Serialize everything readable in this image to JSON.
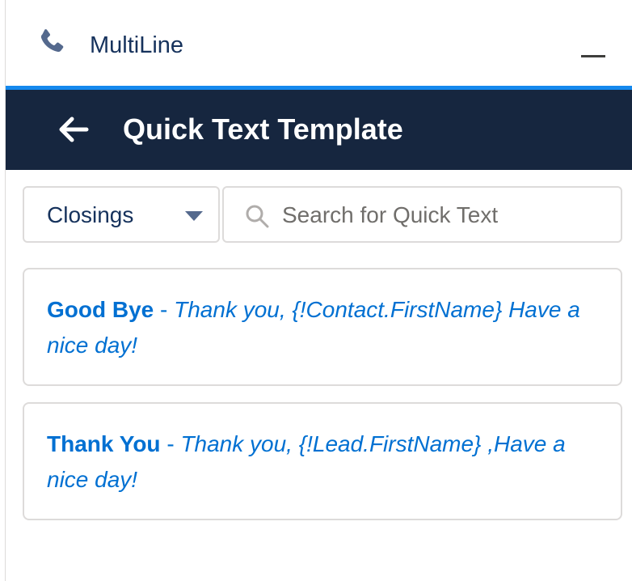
{
  "utility": {
    "title": "MultiLine",
    "icon": "phone-icon",
    "minimize_icon": "minimize-icon"
  },
  "header": {
    "title": "Quick Text Template",
    "back_icon": "arrow-left-icon",
    "background_color": "#16263f",
    "accent_color": "#1589ee"
  },
  "filter": {
    "selected": "Closings",
    "icon": "caret-down-icon"
  },
  "search": {
    "placeholder": "Search for Quick Text",
    "value": "",
    "icon": "search-icon"
  },
  "templates": [
    {
      "name": "Good Bye",
      "separator": " - ",
      "message": "Thank you, {!Contact.FirstName} Have a nice day!"
    },
    {
      "name": "Thank You",
      "separator": " - ",
      "message": "Thank you, {!Lead.FirstName} ,Have a nice day!"
    }
  ],
  "colors": {
    "link": "#0070d2",
    "text": "#16325c",
    "border": "#dddbda"
  }
}
